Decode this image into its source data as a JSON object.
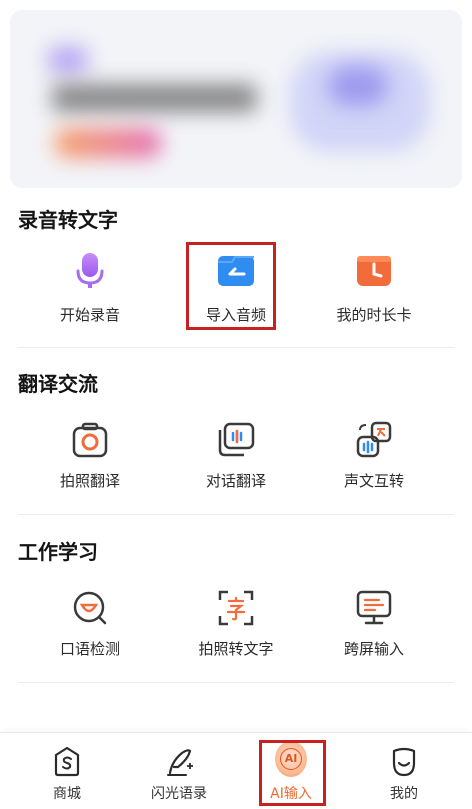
{
  "sections": [
    {
      "title": "录音转文字",
      "items": [
        {
          "label": "开始录音",
          "icon": "microphone-icon"
        },
        {
          "label": "导入音频",
          "icon": "folder-import-icon"
        },
        {
          "label": "我的时长卡",
          "icon": "clock-card-icon"
        }
      ]
    },
    {
      "title": "翻译交流",
      "items": [
        {
          "label": "拍照翻译",
          "icon": "camera-translate-icon"
        },
        {
          "label": "对话翻译",
          "icon": "dialog-translate-icon"
        },
        {
          "label": "声文互转",
          "icon": "voice-text-convert-icon"
        }
      ]
    },
    {
      "title": "工作学习",
      "items": [
        {
          "label": "口语检测",
          "icon": "speech-check-icon"
        },
        {
          "label": "拍照转文字",
          "icon": "scan-text-icon"
        },
        {
          "label": "跨屏输入",
          "icon": "cross-screen-icon"
        }
      ]
    }
  ],
  "nav": {
    "items": [
      {
        "label": "商城",
        "icon": "shop-icon"
      },
      {
        "label": "闪光语录",
        "icon": "quill-icon"
      },
      {
        "label": "AI输入",
        "icon": "ai-icon",
        "badge": "AI",
        "active": true
      },
      {
        "label": "我的",
        "icon": "profile-icon"
      }
    ]
  },
  "colors": {
    "accent": "#f06a32",
    "highlight_border": "#c62222",
    "icon_orange": "#f26b3a",
    "icon_blue": "#2f8cf0",
    "icon_purple": "#a86cf0"
  }
}
